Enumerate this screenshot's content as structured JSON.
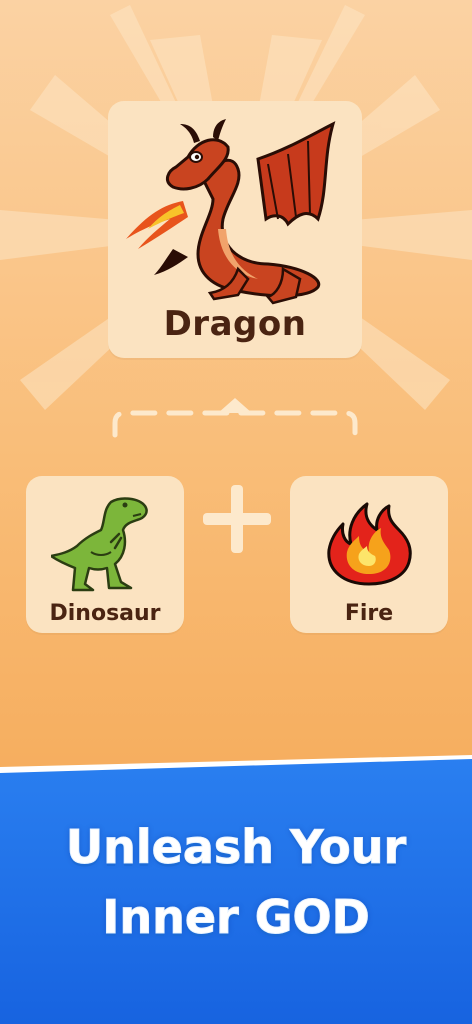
{
  "result": {
    "label": "Dragon",
    "icon": "dragon-icon"
  },
  "ingredients": [
    {
      "label": "Dinosaur",
      "icon": "dinosaur-icon"
    },
    {
      "label": "Fire",
      "icon": "fire-icon"
    }
  ],
  "operator": {
    "icon": "plus-icon"
  },
  "headline": {
    "line1": "Unleash Your",
    "line2": "Inner GOD"
  },
  "colors": {
    "background_top": "#fbd2a3",
    "background_bottom": "#f5a955",
    "card": "#fbe3c1",
    "label_text": "#4a2412",
    "banner_blue": "#1d6fe6"
  }
}
